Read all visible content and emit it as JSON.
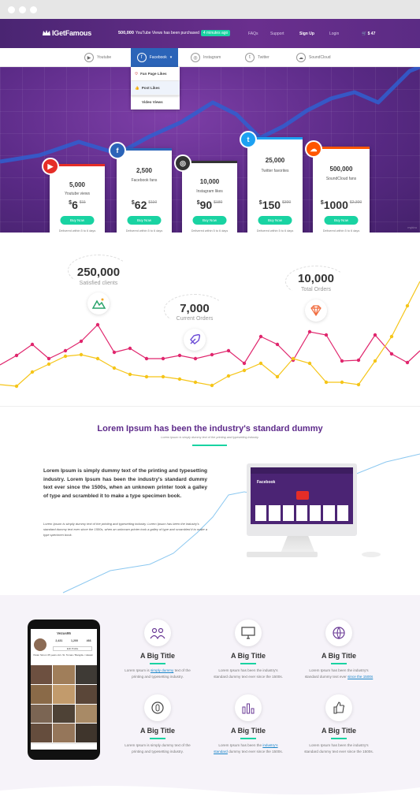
{
  "header": {
    "logo": "IGetFamous",
    "announce_count": "500,000",
    "announce_text": "YouTube Views has been purchased",
    "announce_badge": "4 minutes ago",
    "links": [
      "FAQs",
      "Support",
      "Sign Up",
      "Login"
    ],
    "cart": "$ 47"
  },
  "nav": {
    "items": [
      "Youtube",
      "Facebook",
      "Instagram",
      "Twitter",
      "SoundCloud"
    ],
    "active": "Facebook",
    "dropdown": [
      "Fan Page Likes",
      "Post Likes",
      "Video Views"
    ]
  },
  "cards": [
    {
      "qty": "5,000",
      "label": "Youtube views",
      "price": "6",
      "old": "11",
      "buy": "Buy Now",
      "delivery": "Delivered within 5 to 6 days",
      "color": "#e52d27",
      "icon": "youtube-icon"
    },
    {
      "qty": "2,500",
      "label": "Facebook fans",
      "price": "62",
      "old": "110",
      "buy": "Buy Now",
      "delivery": "Delivered within 5 to 6 days",
      "color": "#2b64b8",
      "icon": "facebook-icon"
    },
    {
      "qty": "10,000",
      "label": "Instagram likes",
      "price": "90",
      "old": "180",
      "buy": "Buy Now",
      "delivery": "Delivered within 5 to 6 days",
      "color": "#333333",
      "icon": "instagram-icon"
    },
    {
      "qty": "25,000",
      "label": "Twitter favorites",
      "price": "150",
      "old": "300",
      "buy": "Buy Now",
      "delivery": "Delivered within 5 to 6 days",
      "color": "#1da1f2",
      "icon": "twitter-icon"
    },
    {
      "qty": "500,000",
      "label": "SoundCloud fans",
      "price": "1000",
      "old": "2,300",
      "buy": "Buy Now",
      "delivery": "Delivered within 5 to 6 days",
      "color": "#ff5500",
      "icon": "soundcloud-icon"
    }
  ],
  "hero_watermark": "mykiru",
  "stats": [
    {
      "num": "250,000",
      "label": "Satisfied clients",
      "icon": "landscape-icon"
    },
    {
      "num": "7,000",
      "label": "Current Orders",
      "icon": "rocket-icon"
    },
    {
      "num": "10,000",
      "label": "Total Orders",
      "icon": "diamond-icon"
    }
  ],
  "lorem": {
    "title": "Lorem Ipsum has been the industry's standard dummy",
    "subtitle": "Lorem Ipsum is simply dummy text of the printing and typesetting industry.",
    "p1": "Lorem Ipsum is simply dummy text of the printing and typesetting industry. Lorem Ipsum has been the industry's standard dummy text ever since the 1500s, when an unknown printer took a galley of type and scrambled it to make a type specimen book.",
    "p2": "Lorem Ipsum is simply dummy text of the printing and typesetting industry. Lorem Ipsum has been the industry's standard dummy text ever since the 1500s, when an unknown printer took a galley of type and scrambled it to make a type specimen book.",
    "screen_label": "Facebook"
  },
  "phone": {
    "username": "Vezus95",
    "stats": [
      "2,431",
      "1,200",
      "466"
    ],
    "edit": "Edit Profile",
    "bio": "Vivian Simon 35 years old • St. Tomas / Bangda ♪ Hawaii"
  },
  "features": [
    {
      "title": "A Big Title",
      "pre": "Lorem Ipsum is ",
      "link": "simply dummy",
      "post": " text of the printing and typesetting industry.",
      "icon": "people-icon"
    },
    {
      "title": "A Big Title",
      "pre": "Lorem Ipsum has been the industry's standard dummy text ever since the 1500s.",
      "link": "",
      "post": "",
      "icon": "monitor-icon"
    },
    {
      "title": "A Big Title",
      "pre": "Lorem Ipsum has been the industry's standard dummy text ever ",
      "link": "since the 1500s",
      "post": "",
      "icon": "globe-icon"
    },
    {
      "title": "A Big Title",
      "pre": "Lorem Ipsum is simply dummy text of the printing and typesetting industry.",
      "link": "",
      "post": "",
      "icon": "timer-icon"
    },
    {
      "title": "A Big Title",
      "pre": "Lorem Ipsum has been the ",
      "link": "industry's standard",
      "post": " dummy text ever since the 1500s.",
      "icon": "bar-chart-icon"
    },
    {
      "title": "A Big Title",
      "pre": "Lorem Ipsum has been the industry's standard dummy text ever since the 1500s.",
      "link": "",
      "post": "",
      "icon": "thumbs-up-icon"
    }
  ],
  "colors": {
    "purple": "#5d2a8a",
    "accent": "#19d3a2",
    "pink": "#e0266d",
    "yellow": "#f5c518"
  }
}
